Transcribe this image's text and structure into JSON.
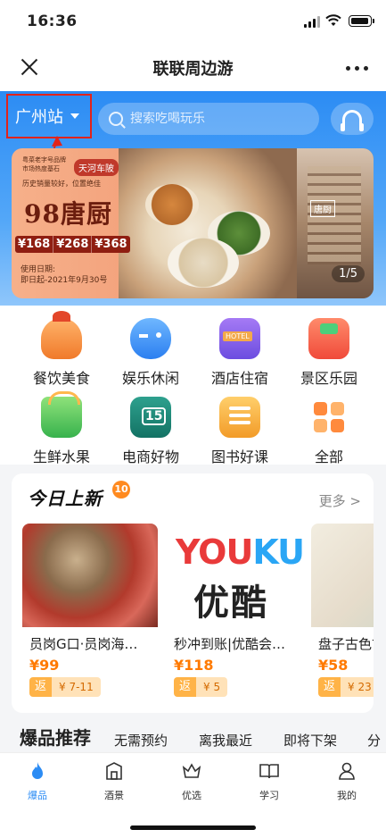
{
  "status_bar": {
    "time": "16:36"
  },
  "nav": {
    "title": "联联周边游"
  },
  "header": {
    "city": "广州站",
    "search_placeholder": "搜索吃喝玩乐"
  },
  "banner": {
    "tag_small": "粤菜老字号品牌 市场热度基石",
    "tag_location": "天河车陂",
    "desc": "历史销量较好，位置绝佳",
    "brand": "98唐厨",
    "prices": [
      "¥168",
      "¥268",
      "¥368"
    ],
    "date_label": "使用日期:",
    "date_value": "即日起-2021年9月30号",
    "page_indicator": "1/5",
    "building_sign": "唐厨"
  },
  "categories": [
    {
      "label": "餐饮美食",
      "icon": "food-icon"
    },
    {
      "label": "娱乐休闲",
      "icon": "gamepad-icon"
    },
    {
      "label": "酒店住宿",
      "icon": "hotel-icon"
    },
    {
      "label": "景区乐园",
      "icon": "park-icon"
    },
    {
      "label": "生鲜水果",
      "icon": "fruit-basket-icon"
    },
    {
      "label": "电商好物",
      "icon": "shopping-bag-icon"
    },
    {
      "label": "图书好课",
      "icon": "book-icon"
    },
    {
      "label": "全部",
      "icon": "grid-icon"
    }
  ],
  "today_new": {
    "title": "今日上新",
    "count": "10",
    "more": "更多 >",
    "items": [
      {
        "name": "员岗G口·员岗海…",
        "price": "¥99",
        "rebate_label": "返",
        "rebate_value": "¥ 7-11"
      },
      {
        "name": "秒冲到账|优酷会…",
        "price": "¥118",
        "rebate_label": "返",
        "rebate_value": "¥ 5",
        "logo_text": "YOUKU",
        "logo_cn": "优酷"
      },
      {
        "name": "盘子古色古",
        "price": "¥58",
        "rebate_label": "返",
        "rebate_value": "¥ 23"
      }
    ]
  },
  "filter_tabs": [
    "爆品推荐",
    "无需预约",
    "离我最近",
    "即将下架",
    "分"
  ],
  "bottom_tabs": [
    {
      "label": "爆品",
      "icon": "flame-icon",
      "active": true
    },
    {
      "label": "酒景",
      "icon": "hotel-building-icon"
    },
    {
      "label": "优选",
      "icon": "crown-basket-icon"
    },
    {
      "label": "学习",
      "icon": "open-book-icon"
    },
    {
      "label": "我的",
      "icon": "person-icon"
    }
  ],
  "colors": {
    "accent": "#2c8cf4",
    "price": "#ff7a00",
    "annotation": "#e2231a"
  }
}
